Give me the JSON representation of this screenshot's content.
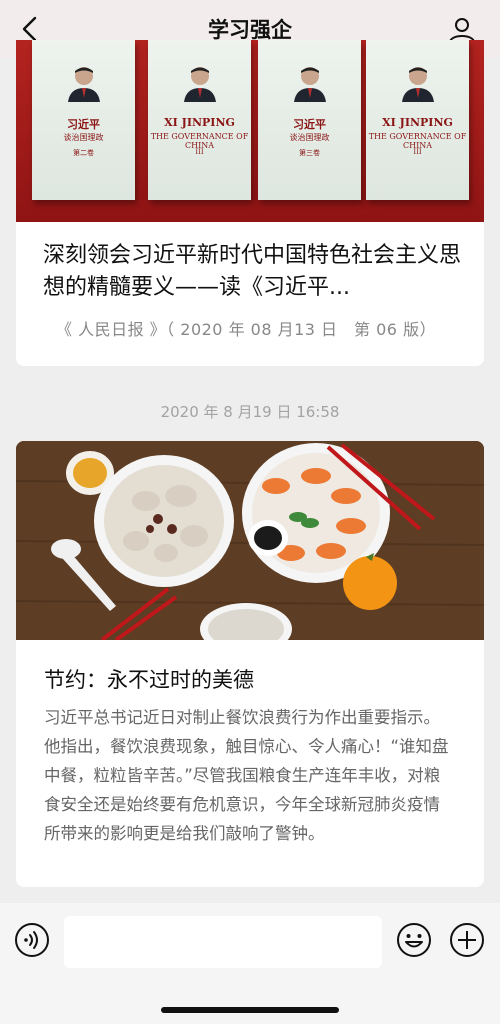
{
  "nav": {
    "title": "学习强企",
    "back_icon": "chevron-left-icon",
    "user_icon": "user-icon"
  },
  "article1": {
    "books": [
      {
        "title": "习近平",
        "subtitle": "谈治国理政",
        "volume": "第二卷"
      },
      {
        "title": "XI JINPING",
        "subtitle": "THE GOVERNANCE OF CHINA",
        "volume": "III"
      },
      {
        "title": "习近平",
        "subtitle": "谈治国理政",
        "volume": "第三卷"
      },
      {
        "title": "XI JINPING",
        "subtitle": "THE GOVERNANCE OF CHINA",
        "volume": "III"
      }
    ],
    "headline": "深刻领会习近平新时代中国特色社会主义思想的精髓要义——读《习近平...",
    "source": "《 人民日报 》（ 2020 年 08 月13 日　第 06 版）"
  },
  "timestamp": "2020 年 8 月19 日 16:58",
  "article2": {
    "headline": "节约：永不过时的美德",
    "body": "习近平总书记近日对制止餐饮浪费行为作出重要指示。他指出，餐饮浪费现象，触目惊心、令人痛心！“谁知盘中餐，粒粒皆辛苦。”尽管我国粮食生产连年丰收，对粮食安全还是始终要有危机意识，今年全球新冠肺炎疫情所带来的影响更是给我们敲响了警钟。"
  },
  "bottom_bar": {
    "voice_icon": "voice-icon",
    "input_value": "",
    "emoji_icon": "emoji-icon",
    "plus_icon": "plus-icon"
  }
}
